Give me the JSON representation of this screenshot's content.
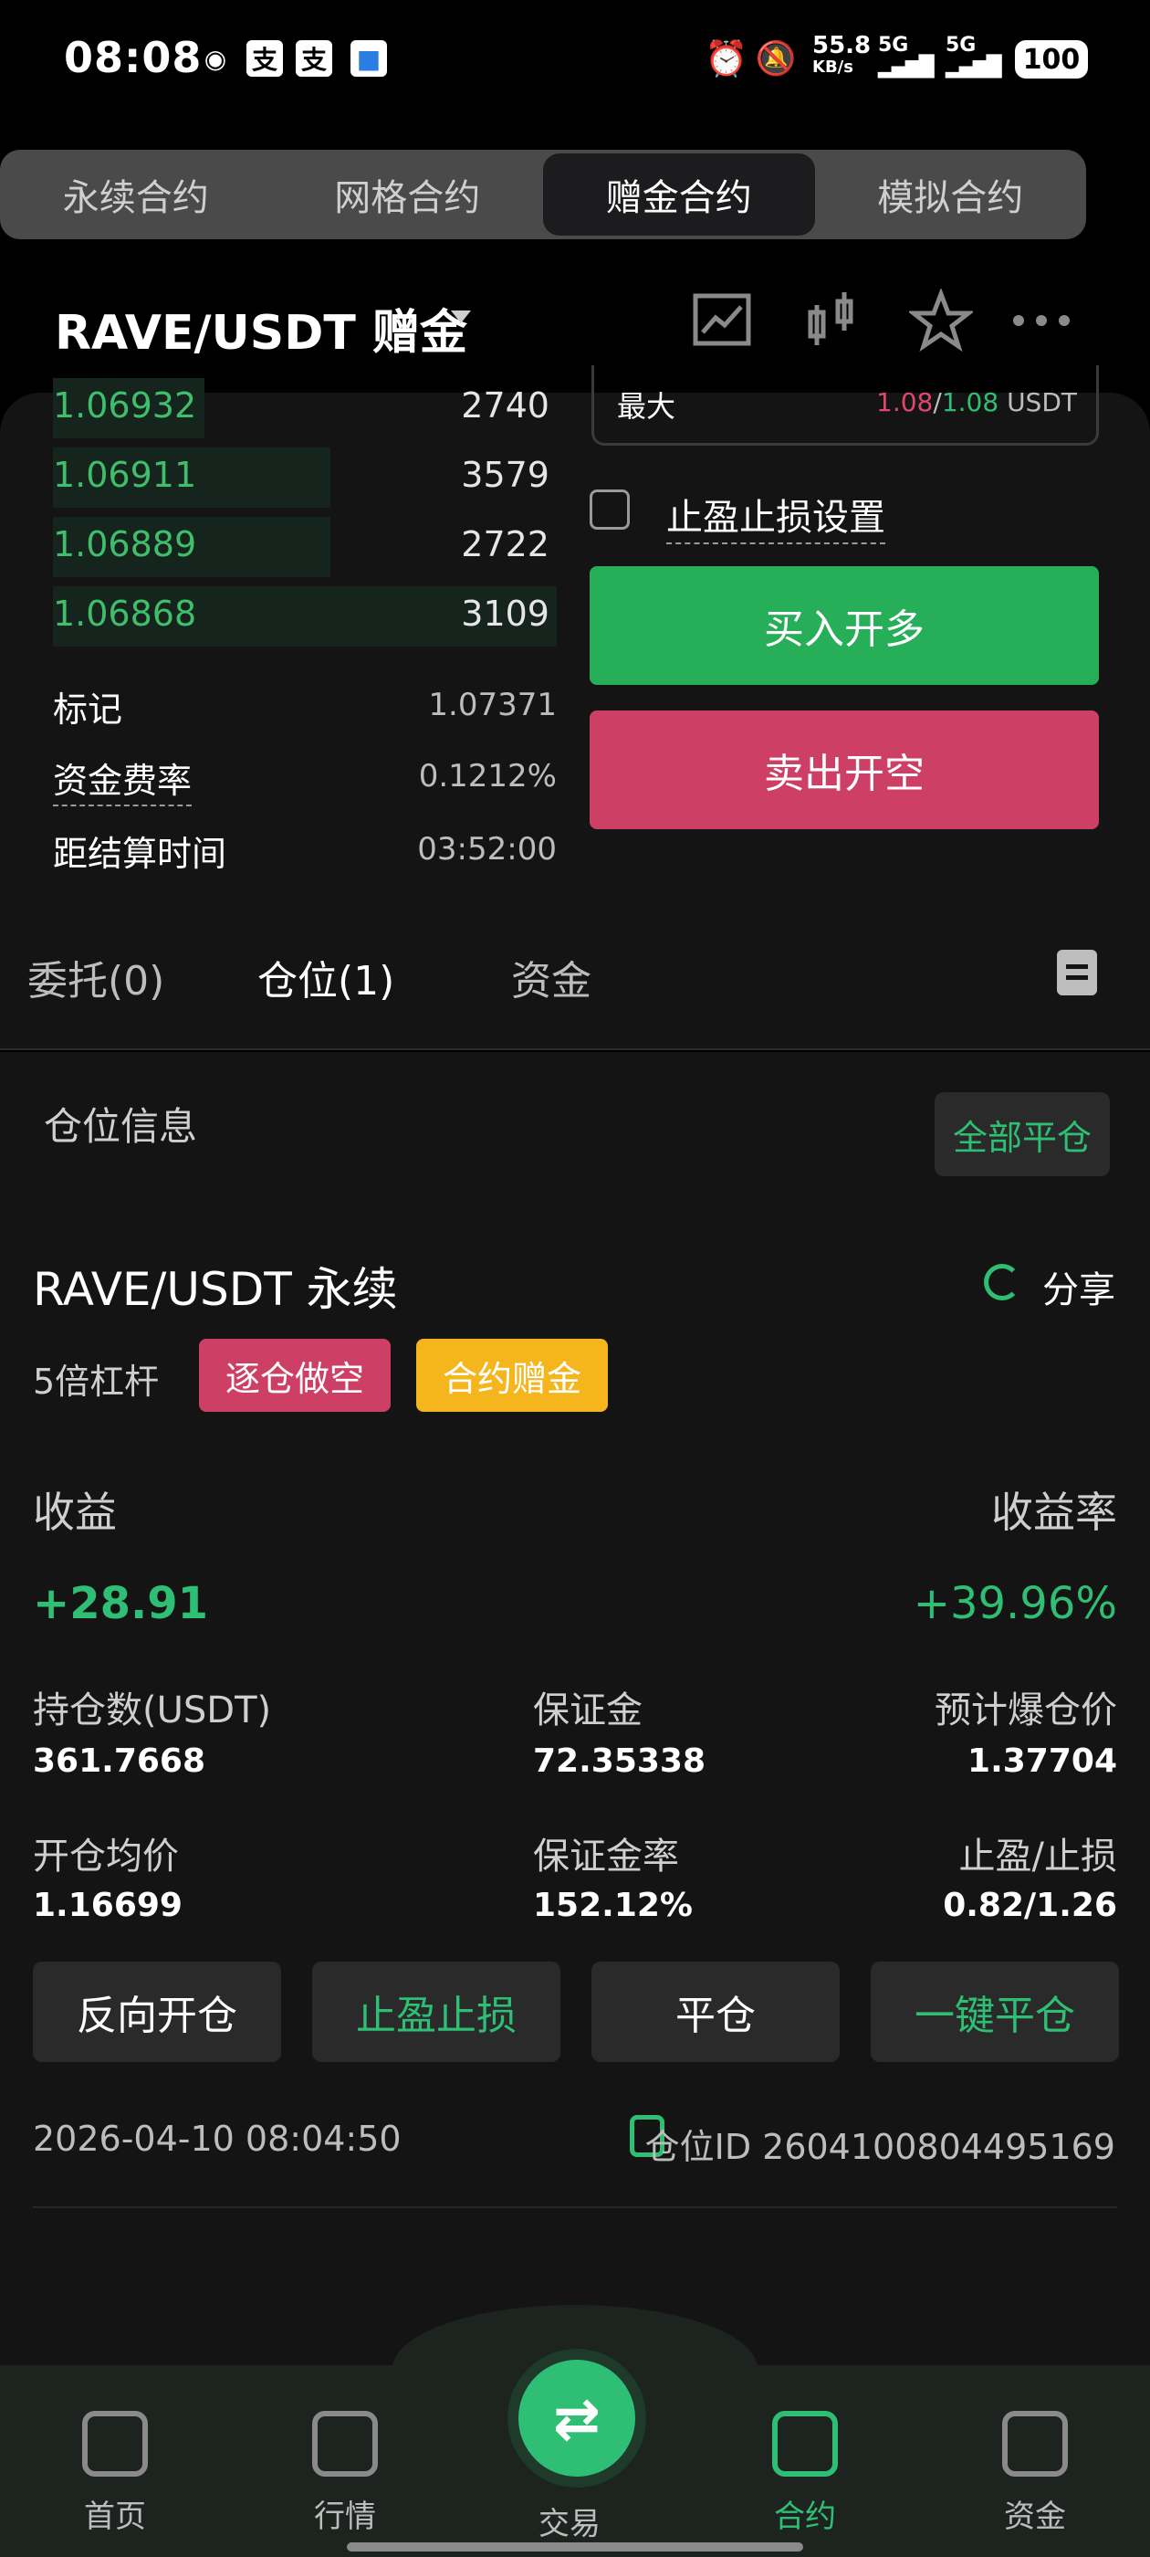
{
  "status_bar": {
    "time": "08:08",
    "net_speed": "55.8",
    "net_unit": "KB/s",
    "sig1": "5G",
    "sig2": "5G",
    "battery": "100"
  },
  "top_tabs": [
    {
      "label": "永续合约",
      "active": false
    },
    {
      "label": "网格合约",
      "active": false
    },
    {
      "label": "赠金合约",
      "active": true
    },
    {
      "label": "模拟合约",
      "active": false
    }
  ],
  "pair": {
    "title": "RAVE/USDT  赠金"
  },
  "orderbook": [
    {
      "price": "1.06932",
      "qty": "2740",
      "depth": 0.3
    },
    {
      "price": "1.06911",
      "qty": "3579",
      "depth": 0.55
    },
    {
      "price": "1.06889",
      "qty": "2722",
      "depth": 0.55
    },
    {
      "price": "1.06868",
      "qty": "3109",
      "depth": 1.0
    }
  ],
  "market_info": {
    "mark_label": "标记",
    "mark_value": "1.07371",
    "funding_label": "资金费率",
    "funding_value": "0.1212%",
    "settle_label": "距结算时间",
    "settle_value": "03:52:00"
  },
  "order_form": {
    "max_label": "最大",
    "max_buy": "1.08",
    "max_sep": "/",
    "max_sell": "1.08",
    "max_unit": "USDT",
    "tpsl_label": "止盈止损设置",
    "buy_label": "买入开多",
    "sell_label": "卖出开空"
  },
  "sub_tabs": [
    {
      "label": "委托(0)",
      "active": false
    },
    {
      "label": "仓位(1)",
      "active": true
    },
    {
      "label": "资金",
      "active": false
    }
  ],
  "position": {
    "section_title": "仓位信息",
    "close_all_label": "全部平仓",
    "title": "RAVE/USDT 永续",
    "share_label": "分享",
    "leverage": "5倍杠杆",
    "badge_short": "逐仓做空",
    "badge_bonus": "合约赠金",
    "pnl_label": "收益",
    "pnl_value": "+28.91",
    "roe_label": "收益率",
    "roe_value": "+39.96%",
    "fields": {
      "size_label": "持仓数(USDT)",
      "size_value": "361.7668",
      "margin_label": "保证金",
      "margin_value": "72.35338",
      "liq_label": "预计爆仓价",
      "liq_value": "1.37704",
      "entry_label": "开仓均价",
      "entry_value": "1.16699",
      "margin_ratio_label": "保证金率",
      "margin_ratio_value": "152.12%",
      "tpsl_label": "止盈/止损",
      "tpsl_value": "0.82/1.26"
    },
    "actions": {
      "reverse": "反向开仓",
      "tpsl": "止盈止损",
      "close": "平仓",
      "one_click_close": "一键平仓"
    },
    "timestamp": "2026-04-10 08:04:50",
    "position_id": "仓位ID 2604100804495169"
  },
  "bottom_nav": {
    "home": "首页",
    "market": "行情",
    "trade": "交易",
    "trade_symbol": "⇄",
    "contract": "合约",
    "assets": "资金"
  },
  "colors": {
    "green": "#2fbf74",
    "buy": "#27ae58",
    "sell": "#cd3f64",
    "bonus": "#f5b51c"
  }
}
